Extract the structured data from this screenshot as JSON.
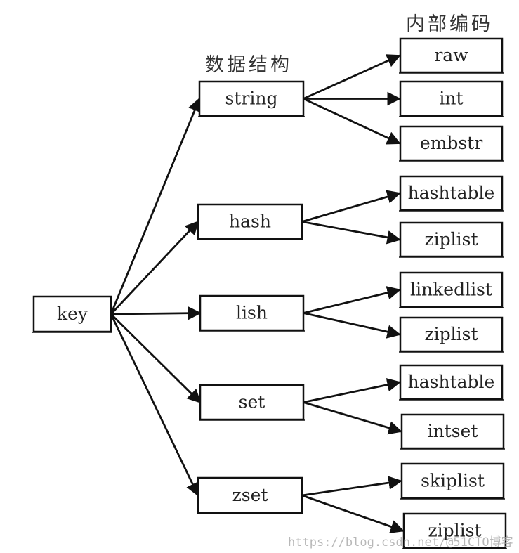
{
  "headers": {
    "structures": "数据结构",
    "encodings": "内部编码"
  },
  "root": "key",
  "structures": [
    {
      "label": "string",
      "encodings": [
        "raw",
        "int",
        "embstr"
      ]
    },
    {
      "label": "hash",
      "encodings": [
        "hashtable",
        "ziplist"
      ]
    },
    {
      "label": "lish",
      "encodings": [
        "linkedlist",
        "ziplist"
      ]
    },
    {
      "label": "set",
      "encodings": [
        "hashtable",
        "intset"
      ]
    },
    {
      "label": "zset",
      "encodings": [
        "skiplist",
        "ziplist"
      ]
    }
  ],
  "watermark": "https://blog.csdn.net/@51CTO博客",
  "colors": {
    "stroke": "#111111",
    "text": "#222222"
  }
}
